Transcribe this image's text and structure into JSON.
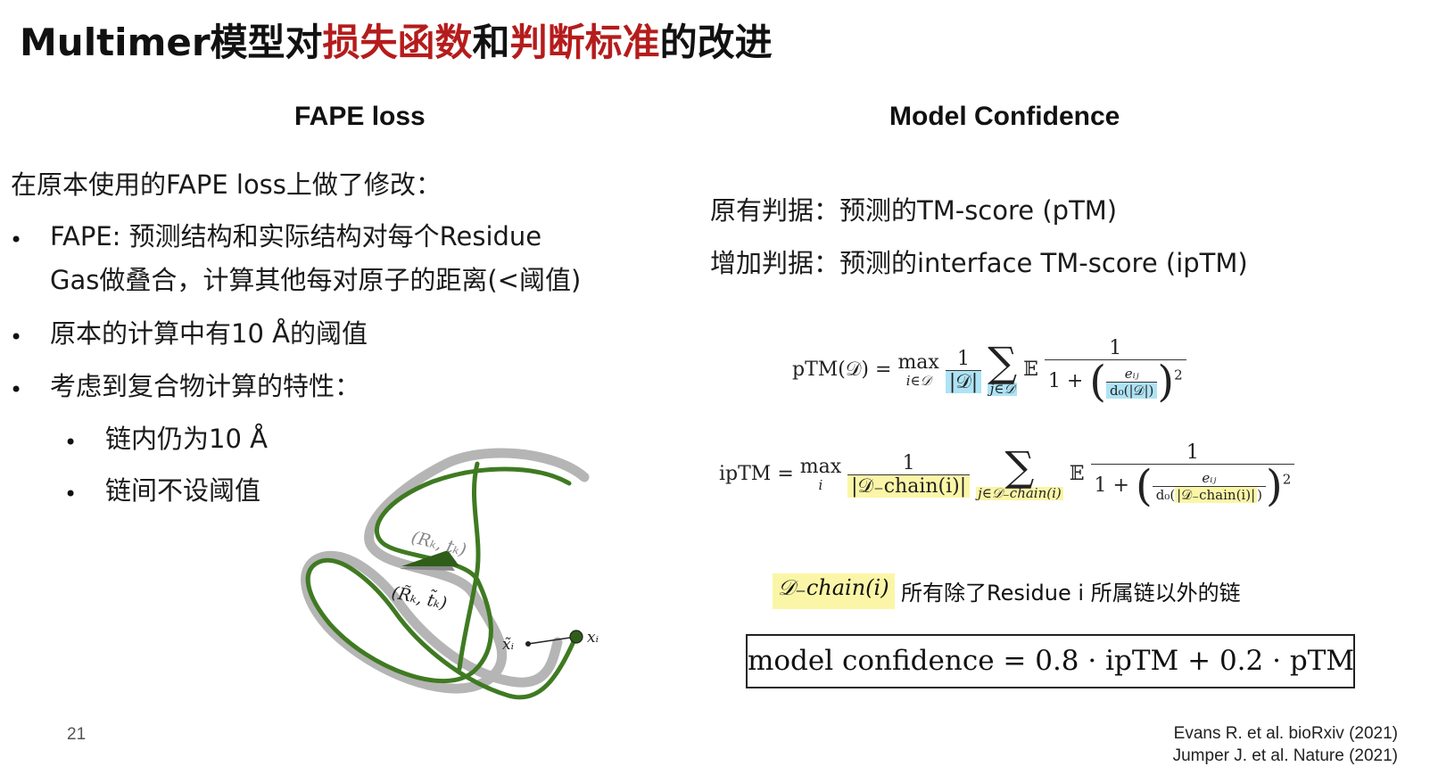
{
  "slide": {
    "title_parts": [
      "Multimer模型对",
      "损失函数",
      "和",
      "判断标准",
      "的改进"
    ],
    "page_number": "21",
    "accent_color": "#b51c1c"
  },
  "left": {
    "heading": "FAPE loss",
    "intro": "在原本使用的FAPE loss上做了修改：",
    "bullets": [
      "FAPE: 预测结构和实际结构对每个Residue",
      "Gas做叠合，计算其他每对原子的距离(<阈值)",
      "原本的计算中有10 Å的阈值",
      "考虑到复合物计算的特性："
    ],
    "sub_bullets": [
      "链内仍为10 Å",
      "链间不设阈值"
    ],
    "bullet_glyph": "•",
    "diagram": {
      "label_true_frame": "(Rₖ, tₖ)",
      "label_pred_frame": "(R̃ₖ, t̃ₖ)",
      "label_pred_atom": "x̃ᵢ",
      "label_true_atom": "xᵢ",
      "colors": {
        "true": "#b5b5b5",
        "pred": "#3f7a22"
      }
    }
  },
  "right": {
    "heading": "Model Confidence",
    "line1": "原有判据：预测的TM-score (pTM)",
    "line2": "增加判据：预测的interface TM-score (ipTM)",
    "ptm": {
      "lhs": "pTM(𝒟) = ",
      "max": "max",
      "max_sub": "i∈𝒟",
      "one": "1",
      "card": "|𝒟|",
      "sum_sub": "j∈𝒟",
      "expect": "𝔼",
      "den_prefix": "1 + ",
      "eij": "eᵢⱼ",
      "d0": "d₀(|𝒟|)",
      "sq": "2"
    },
    "iptm": {
      "lhs": "ipTM = ",
      "max": "max",
      "max_sub": "i",
      "one": "1",
      "card": "|𝒟₋chain(i)|",
      "sum_sub": "j∈𝒟₋chain(i)",
      "expect": "𝔼",
      "den_prefix": "1 + ",
      "eij": "eᵢⱼ",
      "d0_prefix": "d₀(",
      "d0_card": "|𝒟₋chain(i)|",
      "d0_suffix": ")",
      "sq": "2"
    },
    "legend_symbol": "𝒟₋chain(i)",
    "legend_text": "所有除了Residue i 所属链以外的链",
    "confidence_formula": "model confidence = 0.8 · ipTM + 0.2 · pTM"
  },
  "citations": [
    "Evans R. et al. bioRxiv (2021)",
    "Jumper J. et al. Nature (2021)"
  ]
}
